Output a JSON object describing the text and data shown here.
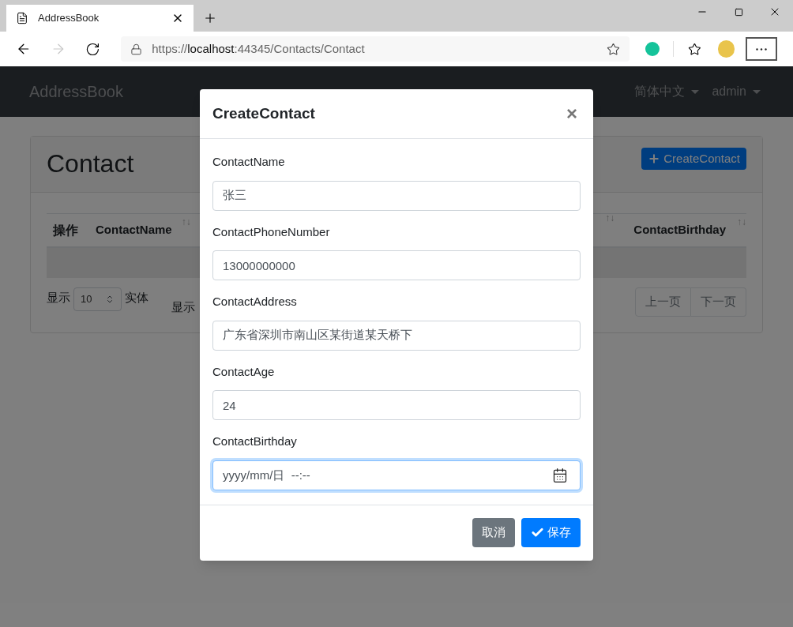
{
  "browser": {
    "tab_title": "AddressBook",
    "url": {
      "scheme": "https://",
      "host": "localhost",
      "rest": ":44345/Contacts/Contact"
    },
    "forward_disabled": true
  },
  "navbar": {
    "brand": "AddressBook",
    "menus": [
      {
        "label": "简体中文"
      },
      {
        "label": "admin"
      }
    ]
  },
  "page": {
    "title": "Contact",
    "create_button": "CreateContact",
    "table": {
      "columns": [
        {
          "label": "操作",
          "sortable": false
        },
        {
          "label": "ContactName",
          "sortable": true
        },
        {
          "sortable": true
        },
        {
          "label": "ContactBirthday",
          "sortable": true
        }
      ],
      "sort_mark": "↑↓"
    },
    "length": {
      "prefix": "显示",
      "value": "10",
      "suffix": "实体"
    },
    "info": "显示",
    "pager": [
      {
        "label": "上一页"
      },
      {
        "label": "下一页"
      }
    ]
  },
  "modal": {
    "title": "CreateContact",
    "close": "×",
    "fields": [
      {
        "kind": "text",
        "label": "ContactName",
        "value": "张三",
        "focused": false
      },
      {
        "kind": "text",
        "label": "ContactPhoneNumber",
        "value": "13000000000",
        "focused": false
      },
      {
        "kind": "text",
        "label": "ContactAddress",
        "value": "广东省深圳市南山区某街道某天桥下",
        "focused": false
      },
      {
        "kind": "text",
        "label": "ContactAge",
        "value": "24",
        "focused": false
      },
      {
        "kind": "datetime",
        "label": "ContactBirthday",
        "placeholder": "yyyy/mm/日  --:--",
        "focused": true
      }
    ],
    "buttons": [
      {
        "kind": "secondary",
        "label": "取消"
      },
      {
        "kind": "primary",
        "label": "保存"
      }
    ]
  }
}
